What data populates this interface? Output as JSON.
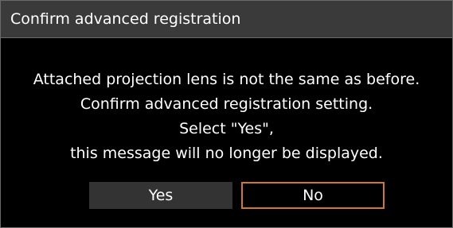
{
  "dialog": {
    "title": "Confirm advanced registration",
    "message_lines": [
      "Attached projection lens is not the same as before.",
      "Confirm advanced registration setting.",
      "Select \"Yes\",",
      "this message will no longer be displayed."
    ],
    "buttons": {
      "yes_label": "Yes",
      "no_label": "No"
    },
    "focused_button": "No"
  },
  "colors": {
    "background": "#000000",
    "titlebar": "#3a3a3a",
    "button": "#333333",
    "focus_border": "#d27a1e",
    "text": "#ffffff"
  }
}
